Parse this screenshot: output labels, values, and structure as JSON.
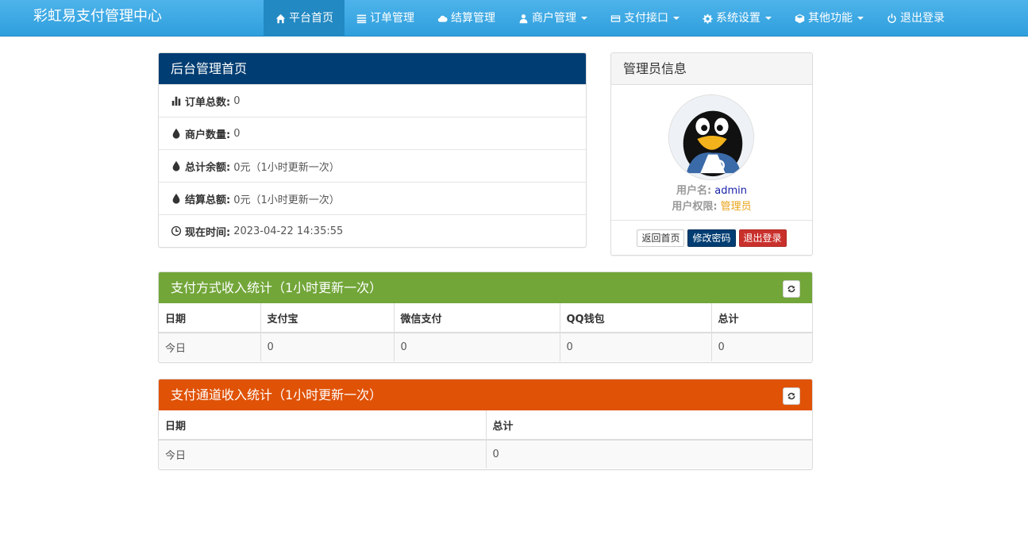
{
  "navbar": {
    "brand": "彩虹易支付管理中心",
    "items": [
      {
        "label": "平台首页",
        "icon": "home-icon",
        "active": true,
        "dropdown": false
      },
      {
        "label": "订单管理",
        "icon": "list-icon",
        "active": false,
        "dropdown": false
      },
      {
        "label": "结算管理",
        "icon": "cloud-icon",
        "active": false,
        "dropdown": false
      },
      {
        "label": "商户管理",
        "icon": "user-icon",
        "active": false,
        "dropdown": true
      },
      {
        "label": "支付接口",
        "icon": "credit-card-icon",
        "active": false,
        "dropdown": true
      },
      {
        "label": "系统设置",
        "icon": "gear-icon",
        "active": false,
        "dropdown": true
      },
      {
        "label": "其他功能",
        "icon": "cube-icon",
        "active": false,
        "dropdown": true
      },
      {
        "label": "退出登录",
        "icon": "power-icon",
        "active": false,
        "dropdown": false
      }
    ]
  },
  "admin_panel": {
    "title": "后台管理首页",
    "stats": [
      {
        "label": "订单总数:",
        "value": "0",
        "icon": "bar-chart-icon"
      },
      {
        "label": "商户数量:",
        "value": "0",
        "icon": "tint-icon"
      },
      {
        "label": "总计余额:",
        "value": "0元（1小时更新一次）",
        "icon": "tint-icon"
      },
      {
        "label": "结算总额:",
        "value": "0元（1小时更新一次）",
        "icon": "tint-icon"
      },
      {
        "label": "现在时间:",
        "value": "2023-04-22 14:35:55",
        "icon": "clock-icon"
      }
    ]
  },
  "admin_info": {
    "title": "管理员信息",
    "username_label": "用户名:",
    "username": "admin",
    "role_label": "用户权限:",
    "role": "管理员",
    "buttons": {
      "home": "返回首页",
      "password": "修改密码",
      "logout": "退出登录"
    }
  },
  "pay_stats": {
    "title": "支付方式收入统计（1小时更新一次）",
    "headers": [
      "日期",
      "支付宝",
      "微信支付",
      "QQ钱包",
      "总计"
    ],
    "rows": [
      [
        "今日",
        "0",
        "0",
        "0",
        "0"
      ]
    ]
  },
  "channel_stats": {
    "title": "支付通道收入统计（1小时更新一次）",
    "headers": [
      "日期",
      "总计"
    ],
    "rows": [
      [
        "今日",
        "0"
      ]
    ]
  },
  "colors": {
    "navbar": "#2e9fdd",
    "admin_header": "#003d72",
    "pay_header": "#72a639",
    "channel_header": "#e05206",
    "username": "#1a23a8",
    "role": "#e8a317"
  }
}
